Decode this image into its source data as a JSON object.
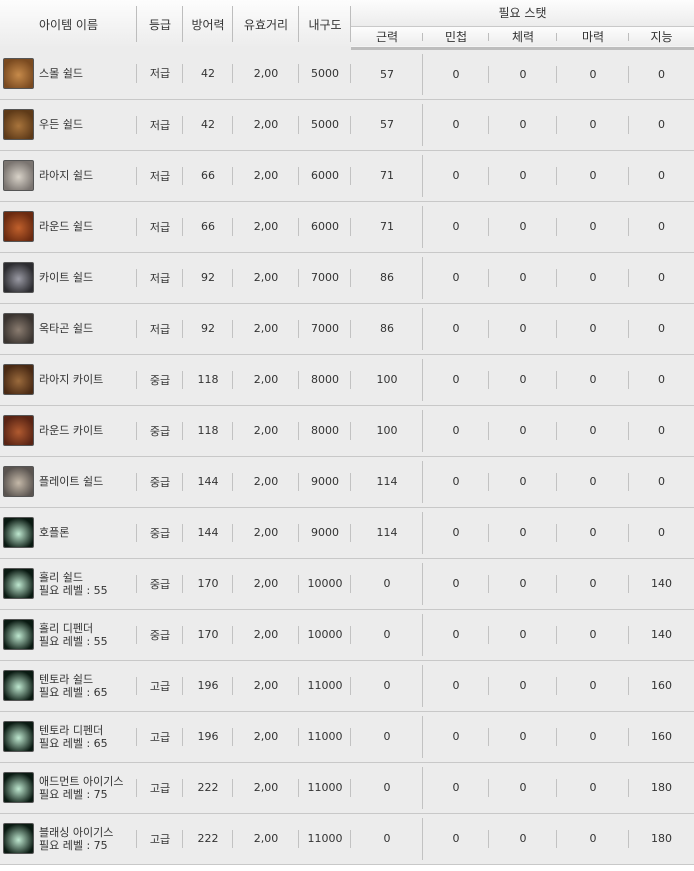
{
  "headers": {
    "name": "아이템 이름",
    "grade": "등급",
    "defense": "방어력",
    "range": "유효거리",
    "durability": "내구도",
    "required_stats": "필요 스탯",
    "str": "근력",
    "dex": "민첩",
    "vit": "체력",
    "mag": "마력",
    "int": "지능"
  },
  "icon_colors": {
    "brown": [
      "#7a4a20",
      "#c68a4a"
    ],
    "wood": [
      "#5e3a18",
      "#a8743c"
    ],
    "silver": [
      "#7a7470",
      "#d8d2c8"
    ],
    "round": [
      "#6a2a10",
      "#c0602c"
    ],
    "kite": [
      "#2c2c30",
      "#9a9aa4"
    ],
    "octa": [
      "#3a3430",
      "#8a7c70"
    ],
    "large_kite": [
      "#4a2a14",
      "#9a6a3c"
    ],
    "round_kite": [
      "#5a2414",
      "#b05a30"
    ],
    "plate": [
      "#5a5450",
      "#c4b8a8"
    ],
    "orb": [
      "#0a1a12",
      "#bfe8d0"
    ]
  },
  "items": [
    {
      "name": "스몰 쉴드",
      "level_label": "",
      "icon": "brown",
      "grade": "저급",
      "defense": "42",
      "range": "2,00",
      "durability": "5000",
      "str": "57",
      "dex": "0",
      "vit": "0",
      "mag": "0",
      "int": "0"
    },
    {
      "name": "우든 쉴드",
      "level_label": "",
      "icon": "wood",
      "grade": "저급",
      "defense": "42",
      "range": "2,00",
      "durability": "5000",
      "str": "57",
      "dex": "0",
      "vit": "0",
      "mag": "0",
      "int": "0"
    },
    {
      "name": "라아지 쉴드",
      "level_label": "",
      "icon": "silver",
      "grade": "저급",
      "defense": "66",
      "range": "2,00",
      "durability": "6000",
      "str": "71",
      "dex": "0",
      "vit": "0",
      "mag": "0",
      "int": "0"
    },
    {
      "name": "라운드 쉴드",
      "level_label": "",
      "icon": "round",
      "grade": "저급",
      "defense": "66",
      "range": "2,00",
      "durability": "6000",
      "str": "71",
      "dex": "0",
      "vit": "0",
      "mag": "0",
      "int": "0"
    },
    {
      "name": "카이트 쉴드",
      "level_label": "",
      "icon": "kite",
      "grade": "저급",
      "defense": "92",
      "range": "2,00",
      "durability": "7000",
      "str": "86",
      "dex": "0",
      "vit": "0",
      "mag": "0",
      "int": "0"
    },
    {
      "name": "옥타곤 쉴드",
      "level_label": "",
      "icon": "octa",
      "grade": "저급",
      "defense": "92",
      "range": "2,00",
      "durability": "7000",
      "str": "86",
      "dex": "0",
      "vit": "0",
      "mag": "0",
      "int": "0"
    },
    {
      "name": "라아지 카이트",
      "level_label": "",
      "icon": "large_kite",
      "grade": "중급",
      "defense": "118",
      "range": "2,00",
      "durability": "8000",
      "str": "100",
      "dex": "0",
      "vit": "0",
      "mag": "0",
      "int": "0"
    },
    {
      "name": "라운드 카이트",
      "level_label": "",
      "icon": "round_kite",
      "grade": "중급",
      "defense": "118",
      "range": "2,00",
      "durability": "8000",
      "str": "100",
      "dex": "0",
      "vit": "0",
      "mag": "0",
      "int": "0"
    },
    {
      "name": "플레이트 쉴드",
      "level_label": "",
      "icon": "plate",
      "grade": "중급",
      "defense": "144",
      "range": "2,00",
      "durability": "9000",
      "str": "114",
      "dex": "0",
      "vit": "0",
      "mag": "0",
      "int": "0"
    },
    {
      "name": "호플론",
      "level_label": "",
      "icon": "orb",
      "grade": "중급",
      "defense": "144",
      "range": "2,00",
      "durability": "9000",
      "str": "114",
      "dex": "0",
      "vit": "0",
      "mag": "0",
      "int": "0"
    },
    {
      "name": "홀리 쉴드",
      "level_label": "필요 레벨 : 55",
      "icon": "orb",
      "grade": "중급",
      "defense": "170",
      "range": "2,00",
      "durability": "10000",
      "str": "0",
      "dex": "0",
      "vit": "0",
      "mag": "0",
      "int": "140"
    },
    {
      "name": "홀리 디펜더",
      "level_label": "필요 레벨 : 55",
      "icon": "orb",
      "grade": "중급",
      "defense": "170",
      "range": "2,00",
      "durability": "10000",
      "str": "0",
      "dex": "0",
      "vit": "0",
      "mag": "0",
      "int": "140"
    },
    {
      "name": "텐토라 쉴드",
      "level_label": "필요 레벨 : 65",
      "icon": "orb",
      "grade": "고급",
      "defense": "196",
      "range": "2,00",
      "durability": "11000",
      "str": "0",
      "dex": "0",
      "vit": "0",
      "mag": "0",
      "int": "160"
    },
    {
      "name": "텐토라 디펜더",
      "level_label": "필요 레벨 : 65",
      "icon": "orb",
      "grade": "고급",
      "defense": "196",
      "range": "2,00",
      "durability": "11000",
      "str": "0",
      "dex": "0",
      "vit": "0",
      "mag": "0",
      "int": "160"
    },
    {
      "name": "애드먼트 아이기스",
      "level_label": "필요 레벨 : 75",
      "icon": "orb",
      "grade": "고급",
      "defense": "222",
      "range": "2,00",
      "durability": "11000",
      "str": "0",
      "dex": "0",
      "vit": "0",
      "mag": "0",
      "int": "180"
    },
    {
      "name": "블래싱 아이기스",
      "level_label": "필요 레벨 : 75",
      "icon": "orb",
      "grade": "고급",
      "defense": "222",
      "range": "2,00",
      "durability": "11000",
      "str": "0",
      "dex": "0",
      "vit": "0",
      "mag": "0",
      "int": "180"
    }
  ]
}
